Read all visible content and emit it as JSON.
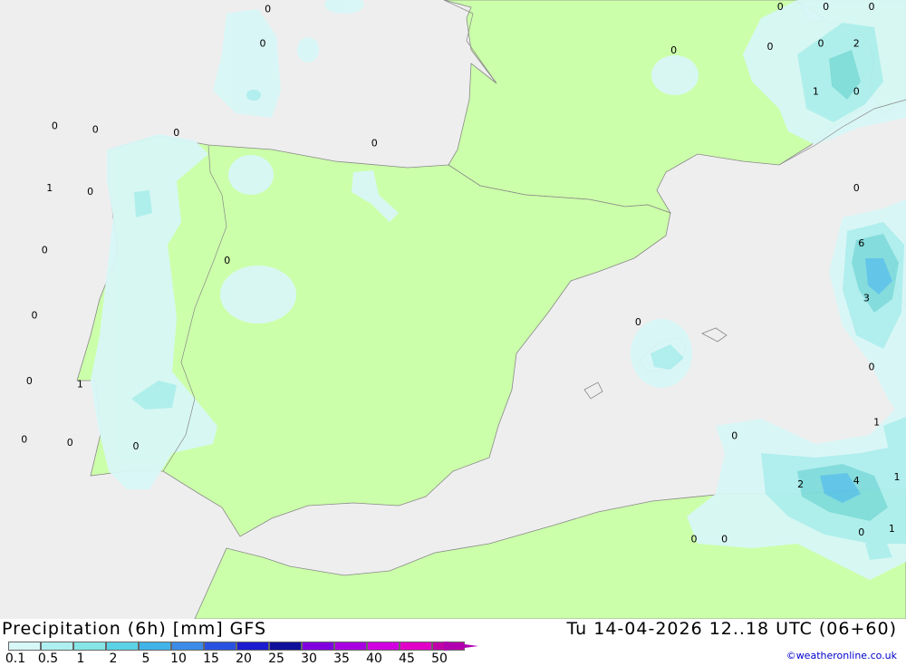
{
  "title": "Precipitation (6h) [mm] GFS",
  "valid_time": "Tu 14-04-2026 12..18 UTC (06+60)",
  "credit": "©weatheronline.co.uk",
  "colors": {
    "sea": "#eeeeee",
    "land": "#ccffaa",
    "precip_light": "#d8f7f7",
    "precip_mid": "#aeefef",
    "precip_heavy": "#80dcdc",
    "precip_core": "#5cc4e8",
    "border": "#888888"
  },
  "legend": {
    "ticks": [
      "0.1",
      "0.5",
      "1",
      "2",
      "5",
      "10",
      "15",
      "20",
      "25",
      "30",
      "35",
      "40",
      "45",
      "50"
    ],
    "colors": [
      "#d8f7f7",
      "#aeefef",
      "#86e6e6",
      "#5cd2e6",
      "#40b4e8",
      "#3a8ce8",
      "#2a52e0",
      "#1c1cd0",
      "#10109a",
      "#8000e0",
      "#a800e0",
      "#d000e0",
      "#e000c8",
      "#c000a8"
    ]
  },
  "labels": [
    {
      "text": "0",
      "lon": -4.4,
      "lat": 44.7
    },
    {
      "text": "0",
      "lon": -4.5,
      "lat": 44.2
    },
    {
      "text": "0",
      "lon": -8.6,
      "lat": 43.0
    },
    {
      "text": "0",
      "lon": -7.8,
      "lat": 42.95
    },
    {
      "text": "0",
      "lon": -6.2,
      "lat": 42.9
    },
    {
      "text": "0",
      "lon": -2.3,
      "lat": 42.75
    },
    {
      "text": "1",
      "lon": -8.7,
      "lat": 42.1
    },
    {
      "text": "0",
      "lon": -7.9,
      "lat": 42.05
    },
    {
      "text": "0",
      "lon": -8.8,
      "lat": 41.2
    },
    {
      "text": "0",
      "lon": -5.2,
      "lat": 41.05
    },
    {
      "text": "0",
      "lon": -9.0,
      "lat": 40.25
    },
    {
      "text": "0",
      "lon": -9.1,
      "lat": 39.3
    },
    {
      "text": "1",
      "lon": -8.1,
      "lat": 39.25
    },
    {
      "text": "0",
      "lon": -9.2,
      "lat": 38.45
    },
    {
      "text": "0",
      "lon": -8.3,
      "lat": 38.4
    },
    {
      "text": "0",
      "lon": -7.0,
      "lat": 38.35
    },
    {
      "text": "0",
      "lon": 3.6,
      "lat": 44.1
    },
    {
      "text": "0",
      "lon": 5.7,
      "lat": 44.8
    },
    {
      "text": "0",
      "lon": 6.6,
      "lat": 44.85
    },
    {
      "text": "0",
      "lon": 7.5,
      "lat": 44.9
    },
    {
      "text": "0",
      "lon": 5.5,
      "lat": 44.15
    },
    {
      "text": "0",
      "lon": 6.5,
      "lat": 44.2
    },
    {
      "text": "2",
      "lon": 7.2,
      "lat": 44.2
    },
    {
      "text": "1",
      "lon": 6.4,
      "lat": 43.5
    },
    {
      "text": "0",
      "lon": 7.2,
      "lat": 43.5
    },
    {
      "text": "0",
      "lon": 7.2,
      "lat": 42.1
    },
    {
      "text": "6",
      "lon": 7.3,
      "lat": 41.3
    },
    {
      "text": "3",
      "lon": 7.4,
      "lat": 40.5
    },
    {
      "text": "0",
      "lon": 7.5,
      "lat": 39.5
    },
    {
      "text": "1",
      "lon": 7.6,
      "lat": 38.7
    },
    {
      "text": "0",
      "lon": 4.8,
      "lat": 38.5
    },
    {
      "text": "2",
      "lon": 6.1,
      "lat": 37.8
    },
    {
      "text": "4",
      "lon": 7.2,
      "lat": 37.85
    },
    {
      "text": "1",
      "lon": 8.0,
      "lat": 37.9
    },
    {
      "text": "0",
      "lon": 7.3,
      "lat": 37.1
    },
    {
      "text": "1",
      "lon": 7.9,
      "lat": 37.15
    },
    {
      "text": "0",
      "lon": 4.0,
      "lat": 37.0
    },
    {
      "text": "0",
      "lon": 4.6,
      "lat": 37.0
    },
    {
      "text": "0",
      "lon": 2.9,
      "lat": 40.15
    }
  ]
}
